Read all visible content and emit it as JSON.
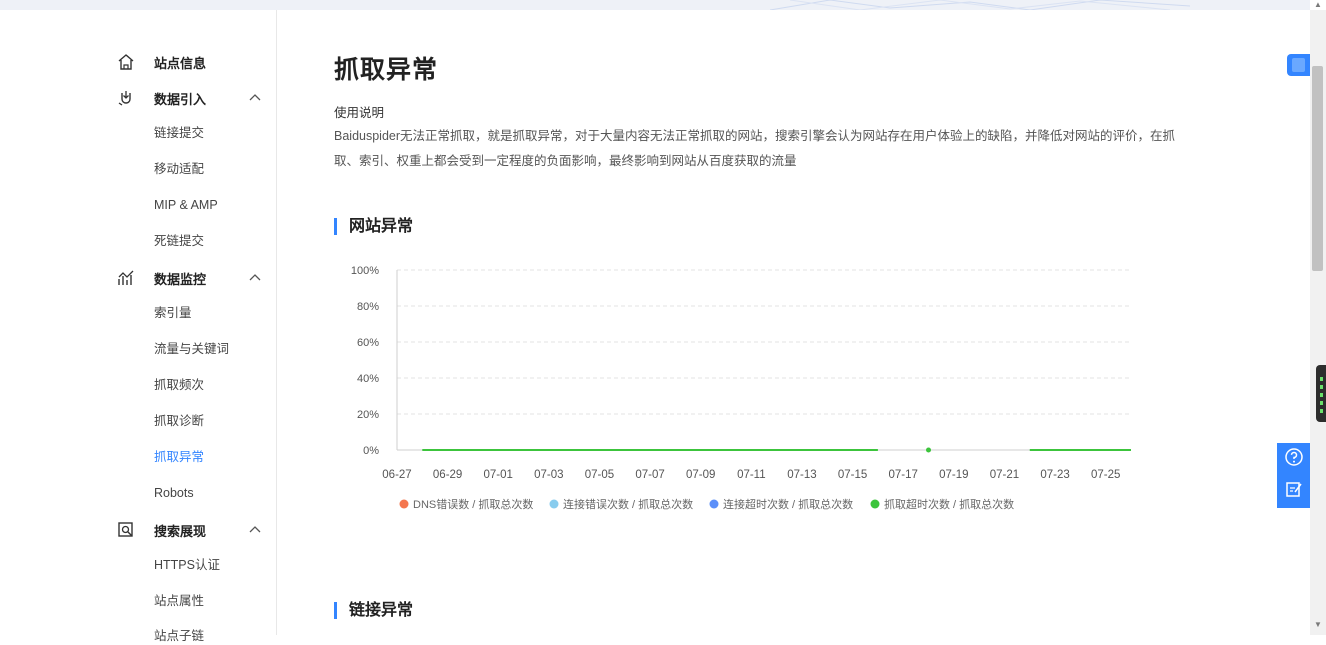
{
  "sidebar": {
    "site_info": "站点信息",
    "data_import": {
      "label": "数据引入",
      "items": [
        "链接提交",
        "移动适配",
        "MIP & AMP",
        "死链提交"
      ]
    },
    "data_monitor": {
      "label": "数据监控",
      "items": [
        "索引量",
        "流量与关键词",
        "抓取频次",
        "抓取诊断",
        "抓取异常",
        "Robots"
      ]
    },
    "search_display": {
      "label": "搜索展现",
      "items": [
        "HTTPS认证",
        "站点属性",
        "站点子链"
      ]
    },
    "active_item": "抓取异常"
  },
  "main": {
    "title": "抓取异常",
    "usage_title": "使用说明",
    "usage_text": "Baiduspider无法正常抓取，就是抓取异常，对于大量内容无法正常抓取的网站，搜索引擎会认为网站存在用户体验上的缺陷，并降低对网站的评价，在抓取、索引、权重上都会受到一定程度的负面影响，最终影响到网站从百度获取的流量",
    "section_site": "网站异常",
    "section_link": "链接异常"
  },
  "chart_data": {
    "type": "line",
    "y_tick_labels": [
      "0%",
      "20%",
      "40%",
      "60%",
      "80%",
      "100%"
    ],
    "ylim": [
      0,
      100
    ],
    "x_tick_labels": [
      "06-27",
      "06-29",
      "07-01",
      "07-03",
      "07-05",
      "07-07",
      "07-09",
      "07-11",
      "07-13",
      "07-15",
      "07-17",
      "07-19",
      "07-21",
      "07-23",
      "07-25"
    ],
    "dates": [
      "06-27",
      "06-28",
      "06-29",
      "06-30",
      "07-01",
      "07-02",
      "07-03",
      "07-04",
      "07-05",
      "07-06",
      "07-07",
      "07-08",
      "07-09",
      "07-10",
      "07-11",
      "07-12",
      "07-13",
      "07-14",
      "07-15",
      "07-16",
      "07-17",
      "07-18",
      "07-19",
      "07-20",
      "07-21",
      "07-22",
      "07-23",
      "07-24",
      "07-25",
      "07-26"
    ],
    "series": [
      {
        "name": "DNS错误数 / 抓取总次数",
        "color": "#f4764e",
        "values": []
      },
      {
        "name": "连接错误次数 / 抓取总次数",
        "color": "#88ccee",
        "values": []
      },
      {
        "name": "连接超时次数 / 抓取总次数",
        "color": "#5b8ff9",
        "values": []
      },
      {
        "name": "抓取超时次数 / 抓取总次数",
        "color": "#3cc43c",
        "values": [
          null,
          0,
          0,
          0,
          0,
          0,
          0,
          0,
          0,
          0,
          0,
          0,
          0,
          0,
          0,
          0,
          0,
          0,
          0,
          0,
          null,
          0,
          null,
          null,
          null,
          0,
          0,
          0,
          0,
          0
        ]
      }
    ],
    "legend_position": "bottom",
    "grid": true
  },
  "colors": {
    "accent": "#3385ff"
  }
}
